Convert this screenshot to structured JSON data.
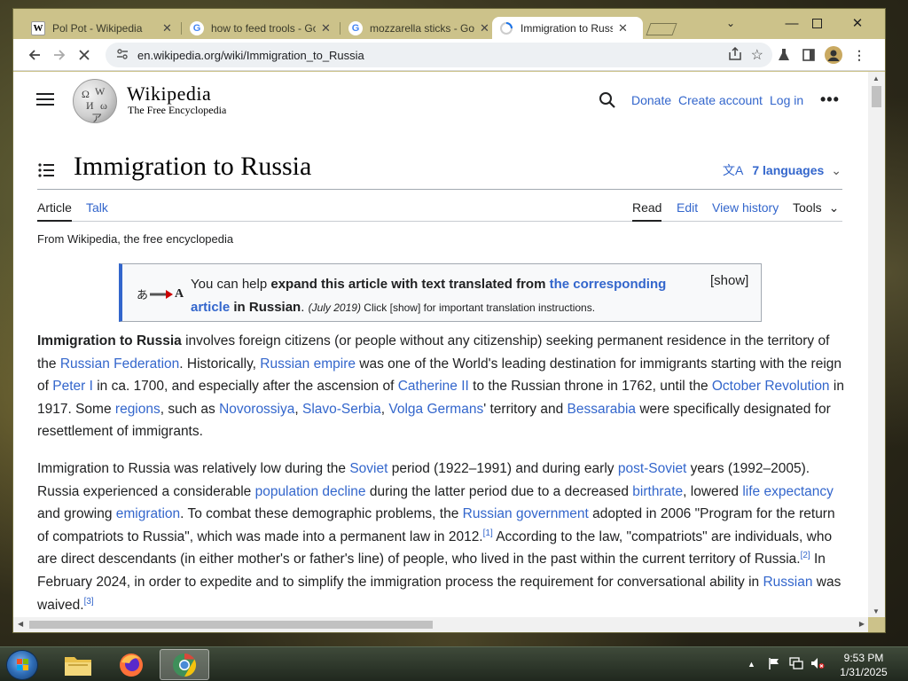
{
  "browser": {
    "tabs": [
      {
        "favicon": "W",
        "title": "Pol Pot - Wikipedia",
        "active": false
      },
      {
        "favicon": "G",
        "title": "how to feed trools - Google Search",
        "active": false
      },
      {
        "favicon": "G",
        "title": "mozzarella sticks - Google Search",
        "active": false
      },
      {
        "favicon": "W",
        "title": "Immigration to Russia - Wikipedia",
        "active": true
      }
    ],
    "url": "en.wikipedia.org/wiki/Immigration_to_Russia"
  },
  "wiki": {
    "wordmark": "Wikipedia",
    "tagline": "The Free Encyclopedia",
    "header_links": [
      "Donate",
      "Create account",
      "Log in"
    ],
    "title": "Immigration to Russia",
    "languages": "7 languages",
    "page_tabs": {
      "article": "Article",
      "talk": "Talk"
    },
    "view_tabs": {
      "read": "Read",
      "edit": "Edit",
      "history": "View history",
      "tools": "Tools"
    },
    "from_line": "From Wikipedia, the free encyclopedia",
    "ambox": {
      "lead": "You can help ",
      "bold1": "expand this article with text translated from ",
      "link": "the corresponding article",
      "bold2": " in Russian",
      "date": "(July 2019)",
      "rest": " Click [show] for important translation instructions.",
      "show": "[show]"
    }
  },
  "taskbar": {
    "time": "9:53 PM",
    "date": "1/31/2025"
  }
}
